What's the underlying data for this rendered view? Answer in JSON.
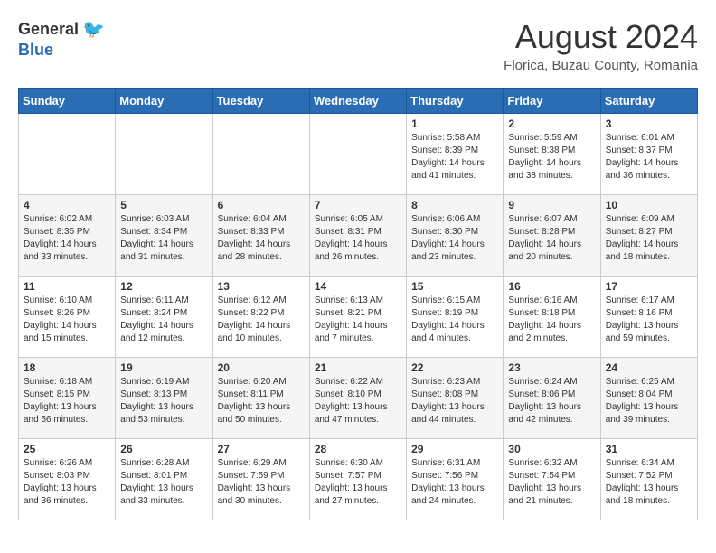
{
  "logo": {
    "general": "General",
    "blue": "Blue"
  },
  "title": {
    "month_year": "August 2024",
    "location": "Florica, Buzau County, Romania"
  },
  "headers": [
    "Sunday",
    "Monday",
    "Tuesday",
    "Wednesday",
    "Thursday",
    "Friday",
    "Saturday"
  ],
  "weeks": [
    [
      {
        "day": "",
        "info": ""
      },
      {
        "day": "",
        "info": ""
      },
      {
        "day": "",
        "info": ""
      },
      {
        "day": "",
        "info": ""
      },
      {
        "day": "1",
        "info": "Sunrise: 5:58 AM\nSunset: 8:39 PM\nDaylight: 14 hours and 41 minutes."
      },
      {
        "day": "2",
        "info": "Sunrise: 5:59 AM\nSunset: 8:38 PM\nDaylight: 14 hours and 38 minutes."
      },
      {
        "day": "3",
        "info": "Sunrise: 6:01 AM\nSunset: 8:37 PM\nDaylight: 14 hours and 36 minutes."
      }
    ],
    [
      {
        "day": "4",
        "info": "Sunrise: 6:02 AM\nSunset: 8:35 PM\nDaylight: 14 hours and 33 minutes."
      },
      {
        "day": "5",
        "info": "Sunrise: 6:03 AM\nSunset: 8:34 PM\nDaylight: 14 hours and 31 minutes."
      },
      {
        "day": "6",
        "info": "Sunrise: 6:04 AM\nSunset: 8:33 PM\nDaylight: 14 hours and 28 minutes."
      },
      {
        "day": "7",
        "info": "Sunrise: 6:05 AM\nSunset: 8:31 PM\nDaylight: 14 hours and 26 minutes."
      },
      {
        "day": "8",
        "info": "Sunrise: 6:06 AM\nSunset: 8:30 PM\nDaylight: 14 hours and 23 minutes."
      },
      {
        "day": "9",
        "info": "Sunrise: 6:07 AM\nSunset: 8:28 PM\nDaylight: 14 hours and 20 minutes."
      },
      {
        "day": "10",
        "info": "Sunrise: 6:09 AM\nSunset: 8:27 PM\nDaylight: 14 hours and 18 minutes."
      }
    ],
    [
      {
        "day": "11",
        "info": "Sunrise: 6:10 AM\nSunset: 8:26 PM\nDaylight: 14 hours and 15 minutes."
      },
      {
        "day": "12",
        "info": "Sunrise: 6:11 AM\nSunset: 8:24 PM\nDaylight: 14 hours and 12 minutes."
      },
      {
        "day": "13",
        "info": "Sunrise: 6:12 AM\nSunset: 8:22 PM\nDaylight: 14 hours and 10 minutes."
      },
      {
        "day": "14",
        "info": "Sunrise: 6:13 AM\nSunset: 8:21 PM\nDaylight: 14 hours and 7 minutes."
      },
      {
        "day": "15",
        "info": "Sunrise: 6:15 AM\nSunset: 8:19 PM\nDaylight: 14 hours and 4 minutes."
      },
      {
        "day": "16",
        "info": "Sunrise: 6:16 AM\nSunset: 8:18 PM\nDaylight: 14 hours and 2 minutes."
      },
      {
        "day": "17",
        "info": "Sunrise: 6:17 AM\nSunset: 8:16 PM\nDaylight: 13 hours and 59 minutes."
      }
    ],
    [
      {
        "day": "18",
        "info": "Sunrise: 6:18 AM\nSunset: 8:15 PM\nDaylight: 13 hours and 56 minutes."
      },
      {
        "day": "19",
        "info": "Sunrise: 6:19 AM\nSunset: 8:13 PM\nDaylight: 13 hours and 53 minutes."
      },
      {
        "day": "20",
        "info": "Sunrise: 6:20 AM\nSunset: 8:11 PM\nDaylight: 13 hours and 50 minutes."
      },
      {
        "day": "21",
        "info": "Sunrise: 6:22 AM\nSunset: 8:10 PM\nDaylight: 13 hours and 47 minutes."
      },
      {
        "day": "22",
        "info": "Sunrise: 6:23 AM\nSunset: 8:08 PM\nDaylight: 13 hours and 44 minutes."
      },
      {
        "day": "23",
        "info": "Sunrise: 6:24 AM\nSunset: 8:06 PM\nDaylight: 13 hours and 42 minutes."
      },
      {
        "day": "24",
        "info": "Sunrise: 6:25 AM\nSunset: 8:04 PM\nDaylight: 13 hours and 39 minutes."
      }
    ],
    [
      {
        "day": "25",
        "info": "Sunrise: 6:26 AM\nSunset: 8:03 PM\nDaylight: 13 hours and 36 minutes."
      },
      {
        "day": "26",
        "info": "Sunrise: 6:28 AM\nSunset: 8:01 PM\nDaylight: 13 hours and 33 minutes."
      },
      {
        "day": "27",
        "info": "Sunrise: 6:29 AM\nSunset: 7:59 PM\nDaylight: 13 hours and 30 minutes."
      },
      {
        "day": "28",
        "info": "Sunrise: 6:30 AM\nSunset: 7:57 PM\nDaylight: 13 hours and 27 minutes."
      },
      {
        "day": "29",
        "info": "Sunrise: 6:31 AM\nSunset: 7:56 PM\nDaylight: 13 hours and 24 minutes."
      },
      {
        "day": "30",
        "info": "Sunrise: 6:32 AM\nSunset: 7:54 PM\nDaylight: 13 hours and 21 minutes."
      },
      {
        "day": "31",
        "info": "Sunrise: 6:34 AM\nSunset: 7:52 PM\nDaylight: 13 hours and 18 minutes."
      }
    ]
  ]
}
